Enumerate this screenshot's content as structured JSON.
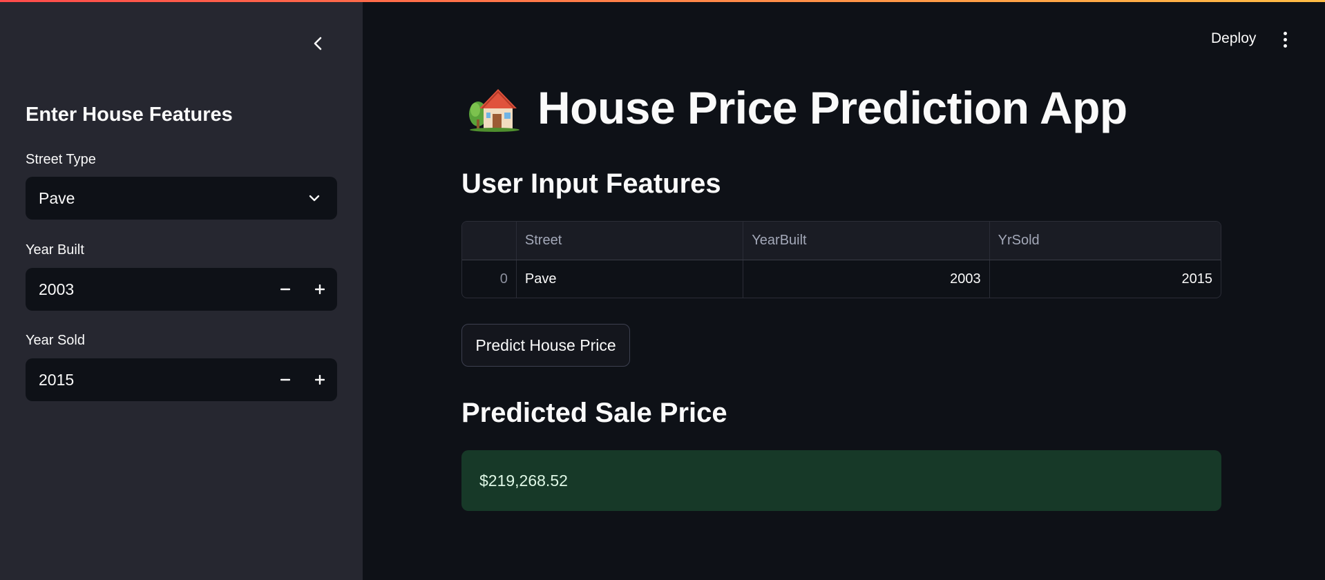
{
  "sidebar": {
    "title": "Enter House Features",
    "street_type": {
      "label": "Street Type",
      "value": "Pave"
    },
    "year_built": {
      "label": "Year Built",
      "value": "2003"
    },
    "year_sold": {
      "label": "Year Sold",
      "value": "2015"
    }
  },
  "header": {
    "deploy_label": "Deploy"
  },
  "main": {
    "title": "House Price Prediction App",
    "user_input_heading": "User Input Features",
    "table": {
      "columns": [
        "",
        "Street",
        "YearBuilt",
        "YrSold"
      ],
      "rows": [
        [
          "0",
          "Pave",
          "2003",
          "2015"
        ]
      ]
    },
    "predict_button_label": "Predict House Price",
    "predicted_heading": "Predicted Sale Price",
    "predicted_value": "$219,268.52"
  },
  "colors": {
    "accent_gradient_start": "#ff4b4b",
    "accent_gradient_end": "#ffbd45",
    "sidebar_bg": "#262730",
    "main_bg": "#0e1117",
    "success_bg": "#173928"
  },
  "icons": {
    "collapse": "chevron-left-icon",
    "select": "chevron-down-icon",
    "minus": "minus-icon",
    "plus": "plus-icon",
    "menu": "vertical-dots-icon",
    "title": "house-icon"
  }
}
